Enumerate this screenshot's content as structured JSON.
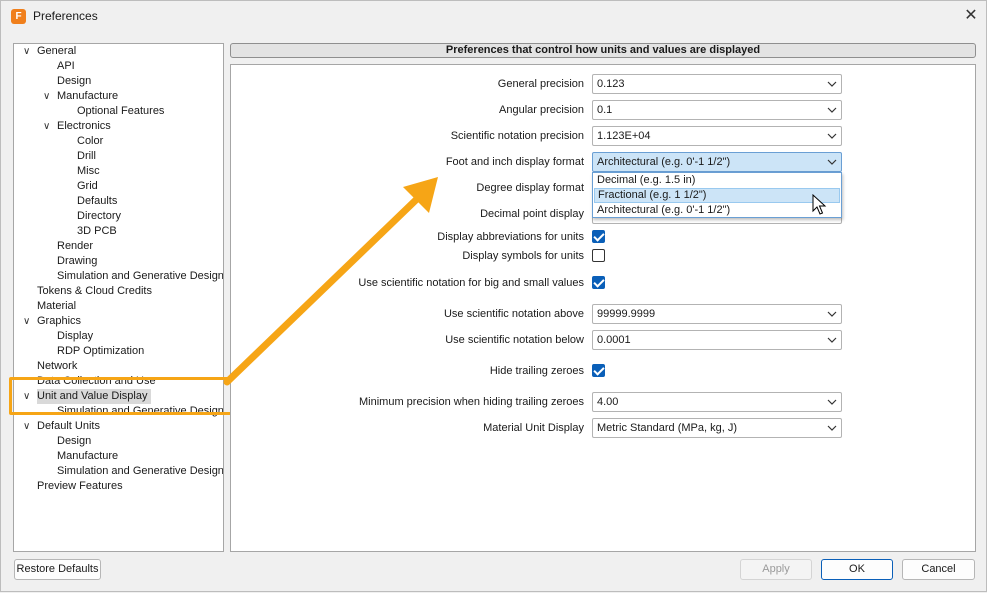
{
  "window": {
    "title": "Preferences",
    "app_icon_letter": "F",
    "close_glyph": "✕",
    "accent_color": "#f6a516"
  },
  "tree": {
    "items": [
      {
        "label": "General",
        "expanded": true
      },
      {
        "label": "API"
      },
      {
        "label": "Design"
      },
      {
        "label": "Manufacture",
        "expanded": true
      },
      {
        "label": "Optional Features"
      },
      {
        "label": "Electronics",
        "expanded": true
      },
      {
        "label": "Color"
      },
      {
        "label": "Drill"
      },
      {
        "label": "Misc"
      },
      {
        "label": "Grid"
      },
      {
        "label": "Defaults"
      },
      {
        "label": "Directory"
      },
      {
        "label": "3D PCB"
      },
      {
        "label": "Render"
      },
      {
        "label": "Drawing"
      },
      {
        "label": "Simulation and Generative Design"
      },
      {
        "label": "Tokens & Cloud Credits"
      },
      {
        "label": "Material"
      },
      {
        "label": "Graphics",
        "expanded": true
      },
      {
        "label": "Display"
      },
      {
        "label": "RDP Optimization"
      },
      {
        "label": "Network"
      },
      {
        "label": "Data Collection and Use"
      },
      {
        "label": "Unit and Value Display",
        "expanded": true,
        "selected": true
      },
      {
        "label": "Simulation and Generative Design"
      },
      {
        "label": "Default Units",
        "expanded": true
      },
      {
        "label": "Design"
      },
      {
        "label": "Manufacture"
      },
      {
        "label": "Simulation and Generative Design"
      },
      {
        "label": "Preview Features"
      }
    ]
  },
  "pane": {
    "header": "Preferences that control how units and values are displayed",
    "general_precision": {
      "label": "General precision",
      "value": "0.123"
    },
    "angular_precision": {
      "label": "Angular precision",
      "value": "0.1"
    },
    "scientific_precision": {
      "label": "Scientific notation precision",
      "value": "1.123E+04"
    },
    "foot_inch_format": {
      "label": "Foot and inch display format",
      "value": "Architectural (e.g. 0'-1 1/2\")",
      "options": [
        "Decimal (e.g. 1.5 in)",
        "Fractional (e.g. 1 1/2\")",
        "Architectural (e.g. 0'-1 1/2\")"
      ],
      "hovered_option": "Fractional (e.g. 1 1/2\")"
    },
    "degree_format": {
      "label": "Degree display format"
    },
    "decimal_point": {
      "label": "Decimal point display"
    },
    "display_abbreviations": {
      "label": "Display abbreviations for units",
      "checked": true
    },
    "display_symbols": {
      "label": "Display symbols for units",
      "checked": false
    },
    "use_scientific": {
      "label": "Use scientific notation for big and small values",
      "checked": true
    },
    "sci_above": {
      "label": "Use scientific notation above",
      "value": "99999.9999"
    },
    "sci_below": {
      "label": "Use scientific notation below",
      "value": "0.0001"
    },
    "hide_trailing": {
      "label": "Hide trailing zeroes",
      "checked": true
    },
    "min_precision": {
      "label": "Minimum precision when hiding trailing zeroes",
      "value": "4.00"
    },
    "material_unit": {
      "label": "Material Unit Display",
      "value": "Metric Standard (MPa, kg, J)"
    }
  },
  "buttons": {
    "restore": "Restore Defaults",
    "apply": "Apply",
    "ok": "OK",
    "cancel": "Cancel"
  }
}
